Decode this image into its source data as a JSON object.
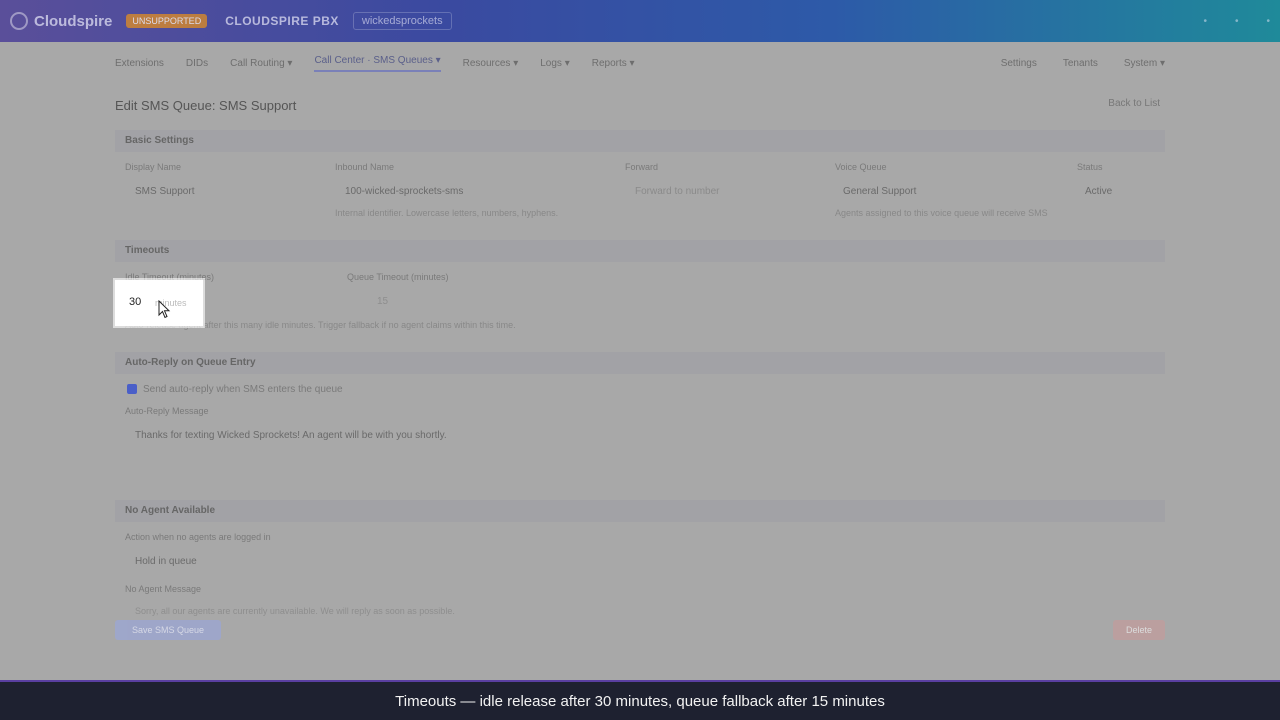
{
  "topbar": {
    "logo": "Cloudspire",
    "env_badge": "UNSUPPORTED",
    "brand": "CLOUDSPIRE PBX",
    "tenant": "wickedsprockets"
  },
  "nav": {
    "items": [
      "Extensions",
      "DIDs",
      "Call Routing ▾",
      "Call Center · SMS Queues ▾",
      "Resources ▾",
      "Logs ▾",
      "Reports ▾"
    ],
    "right": [
      "Settings",
      "Tenants",
      "System ▾"
    ]
  },
  "page": {
    "title": "Edit SMS Queue: SMS Support",
    "back": "Back to List"
  },
  "basic": {
    "head": "Basic Settings",
    "display_name_label": "Display Name",
    "display_name_value": "SMS Support",
    "inbound_label": "Inbound Name",
    "inbound_value": "100-wicked-sprockets-sms",
    "inbound_hint": "Internal identifier. Lowercase letters, numbers, hyphens.",
    "forward_label": "Forward",
    "forward_value": "Forward to number",
    "voice_queue_label": "Voice Queue",
    "voice_queue_value": "General Support",
    "voice_queue_hint": "Agents assigned to this voice queue will receive SMS",
    "status_label": "Status",
    "status_value": "Active"
  },
  "timeouts": {
    "head": "Timeouts",
    "idle_label": "Idle Timeout (minutes)",
    "idle_value": "30",
    "idle_unit": "minutes",
    "queue_label": "Queue Timeout (minutes)",
    "queue_value": "15",
    "hint": "Auto-release agent after this many idle minutes. Trigger fallback if no agent claims within this time."
  },
  "auto_reply": {
    "head": "Auto-Reply on Queue Entry",
    "checkbox_label": "Send auto-reply when SMS enters the queue",
    "message_label": "Auto-Reply Message",
    "message_value": "Thanks for texting Wicked Sprockets! An agent will be with you shortly."
  },
  "no_agent": {
    "head": "No Agent Available",
    "action_label": "Action when no agents are logged in",
    "action_value": "Hold in queue",
    "message_label": "No Agent Message",
    "message_value": "Sorry, all our agents are currently unavailable. We will reply as soon as possible."
  },
  "actions": {
    "save": "Save SMS Queue",
    "delete": "Delete"
  },
  "caption": "Timeouts — idle release after 30 minutes, queue fallback after 15 minutes"
}
